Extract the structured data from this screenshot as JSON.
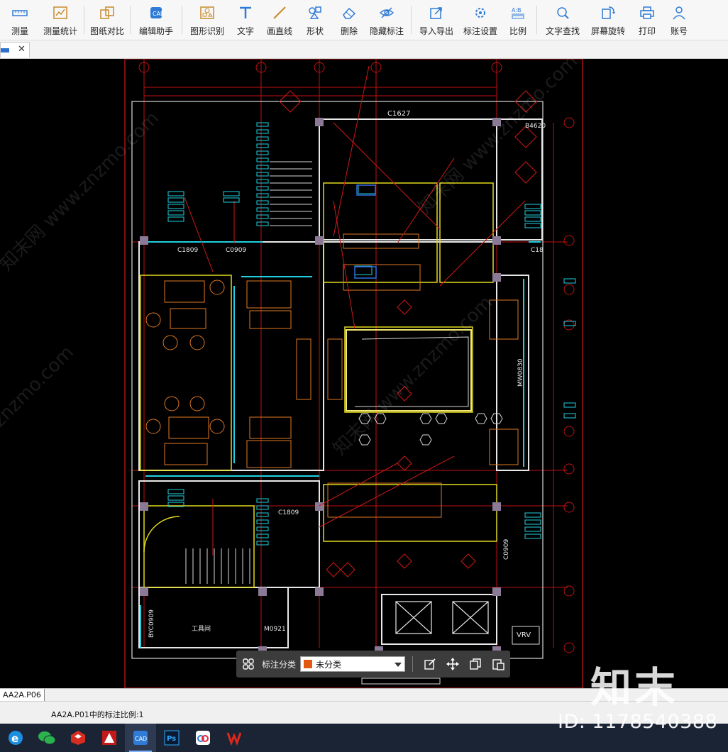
{
  "toolbar": {
    "items": [
      {
        "label": "测量",
        "icon": "ruler-icon"
      },
      {
        "label": "测量统计",
        "icon": "measure-stats-icon"
      },
      {
        "label": "图纸对比",
        "icon": "compare-icon"
      },
      {
        "label": "编辑助手",
        "icon": "edit-assistant-icon"
      },
      {
        "label": "图形识别",
        "icon": "shape-recognize-icon"
      },
      {
        "label": "文字",
        "icon": "text-icon"
      },
      {
        "label": "画直线",
        "icon": "line-icon"
      },
      {
        "label": "形状",
        "icon": "shape-icon"
      },
      {
        "label": "删除",
        "icon": "eraser-icon"
      },
      {
        "label": "隐藏标注",
        "icon": "eye-hide-icon"
      },
      {
        "label": "导入导出",
        "icon": "import-export-icon"
      },
      {
        "label": "标注设置",
        "icon": "mark-settings-icon"
      },
      {
        "label": "比例",
        "icon": "scale-icon"
      },
      {
        "label": "文字查找",
        "icon": "text-search-icon"
      },
      {
        "label": "屏幕旋转",
        "icon": "rotate-icon"
      },
      {
        "label": "打印",
        "icon": "print-icon"
      },
      {
        "label": "账号",
        "icon": "account-icon"
      }
    ]
  },
  "drawing": {
    "labels": {
      "c1627": "C1627",
      "c1809": "C1809",
      "c0909": "C0909",
      "c18": "C18",
      "c1809b": "C1809",
      "m0921": "M0921",
      "byc0909": "BYC0909",
      "room": "工具间",
      "vrv": "VRV",
      "b4620": "B4620",
      "mw0830": "MW0830",
      "c0909b": "C0909"
    }
  },
  "markbar": {
    "label": "标注分类",
    "selected": "未分类",
    "swatch_color": "#e25a12"
  },
  "sheet_tab": "AA2A.P06",
  "status": {
    "text": "AA2A.P01中的标注比例:1"
  },
  "watermark": {
    "brand": "知末",
    "id": "ID: 1178540388"
  },
  "taskbar": {
    "apps": [
      "ie-icon",
      "wechat-icon",
      "sketchup-icon",
      "autocad-icon",
      "cad-viewer-icon",
      "photoshop-icon",
      "baidu-netdisk-icon",
      "wps-icon"
    ]
  }
}
